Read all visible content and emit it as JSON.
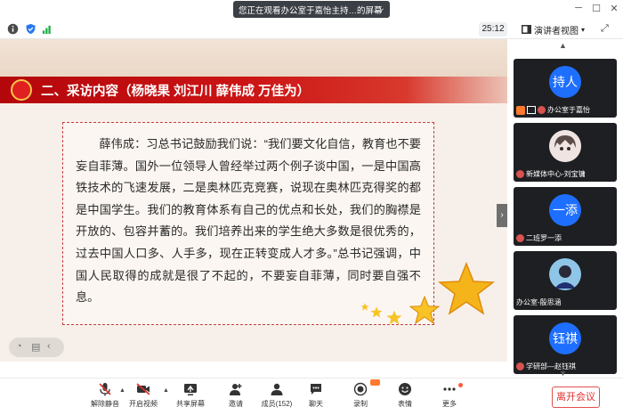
{
  "titlebar": {
    "share_banner": "您正在观看办公室于嘉怡主持…的屏幕",
    "controls": [
      "minimize-icon",
      "maximize-icon",
      "close-icon"
    ]
  },
  "toolbar": {
    "timer": "25:12",
    "view_label": "演讲者视图"
  },
  "slide": {
    "heading": "二、采访内容（杨晓果 刘江川 薛伟成 万佳为）",
    "paragraph": "薛伟成：习总书记鼓励我们说：“我们要文化自信，教育也不要妄自菲薄。国外一位领导人曾经举过两个例子谈中国，一是中国高铁技术的飞速发展，二是奥林匹克竞赛，说现在奥林匹克得奖的都是中国学生。我们的教育体系有自己的优点和长处，我们的胸襟是开放的、包容并蓄的。我们培养出来的学生绝大多数是很优秀的，过去中国人口多、人手多，现在正转变成人才多。”总书记强调，中国人民取得的成就是很了不起的，不要妄自菲薄，同时要自强不息。",
    "colors": {
      "banner": "#c81010",
      "text": "#2a2a2a",
      "border": "#c34040"
    }
  },
  "participants": [
    {
      "avatar_text": "持人",
      "avatar_color": "#1e6fff",
      "name": "办公室于嘉怡",
      "host": true
    },
    {
      "avatar_text": "",
      "avatar_color": "#e8dcd8",
      "name": "新媒体中心-刘宝镛",
      "host": false
    },
    {
      "avatar_text": "一添",
      "avatar_color": "#1e6fff",
      "name": "二班罗一添",
      "host": false
    },
    {
      "avatar_text": "",
      "avatar_color": "#2f7fb7",
      "name": "办公室-殷思涵",
      "host": false
    },
    {
      "avatar_text": "钰祺",
      "avatar_color": "#1e6fff",
      "name": "学研部—赵钰祺",
      "host": false
    }
  ],
  "bottombar": {
    "buttons": [
      {
        "label": "解除静音",
        "icon": "mic-muted-icon"
      },
      {
        "label": "开启视频",
        "icon": "camera-off-icon"
      },
      {
        "label": "共享屏幕",
        "icon": "share-screen-icon"
      },
      {
        "label": "邀请",
        "icon": "invite-icon"
      },
      {
        "label": "成员(152)",
        "icon": "members-icon"
      },
      {
        "label": "聊天",
        "icon": "chat-icon"
      },
      {
        "label": "录制",
        "icon": "record-icon"
      },
      {
        "label": "表情",
        "icon": "emoji-icon"
      },
      {
        "label": "更多",
        "icon": "more-icon"
      }
    ],
    "leave_label": "离开会议"
  }
}
